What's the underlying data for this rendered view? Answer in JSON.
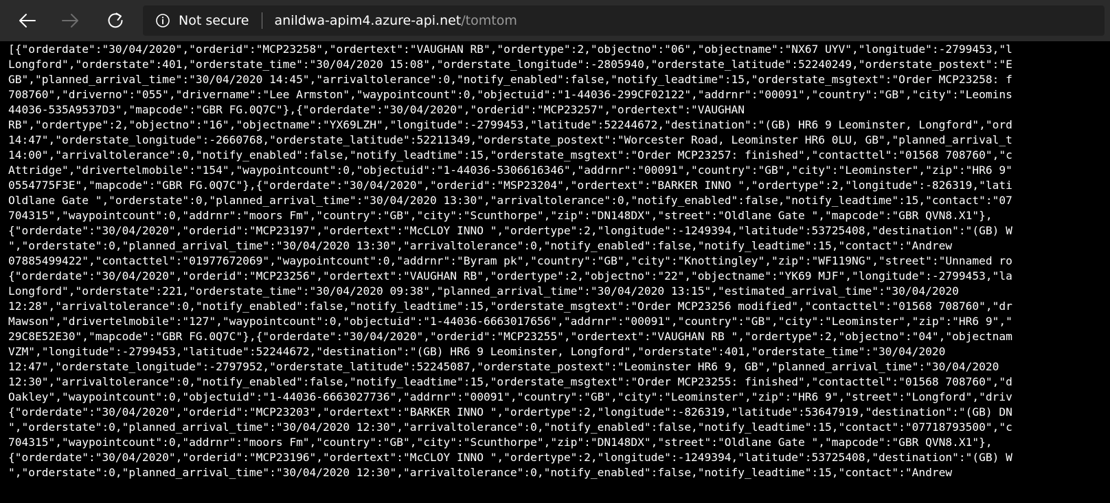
{
  "toolbar": {
    "back_icon": "back-arrow-icon",
    "forward_icon": "forward-arrow-icon",
    "refresh_icon": "refresh-icon",
    "security_icon": "info-circle-icon",
    "security_text": "Not secure",
    "url_host": "anildwa-apim4.azure-api.net",
    "url_path": "/tomtom",
    "colors": {
      "toolbar_bg": "#2b2b2b",
      "addressbar_bg": "#202020",
      "url_path": "#9a9a9a",
      "content_bg": "#000000",
      "content_text": "#ffffff"
    }
  },
  "content": {
    "lines": [
      "[{\"orderdate\":\"30/04/2020\",\"orderid\":\"MCP23258\",\"ordertext\":\"VAUGHAN RB\",\"ordertype\":2,\"objectno\":\"06\",\"objectname\":\"NX67 UYV\",\"longitude\":-2799453,\"l",
      "Longford\",\"orderstate\":401,\"orderstate_time\":\"30/04/2020 15:08\",\"orderstate_longitude\":-2805940,\"orderstate_latitude\":52240249,\"orderstate_postext\":\"E",
      "GB\",\"planned_arrival_time\":\"30/04/2020 14:45\",\"arrivaltolerance\":0,\"notify_enabled\":false,\"notify_leadtime\":15,\"orderstate_msgtext\":\"Order MCP23258: f",
      "708760\",\"driverno\":\"055\",\"drivername\":\"Lee Armston\",\"waypointcount\":0,\"objectuid\":\"1-44036-299CF02122\",\"addrnr\":\"00091\",\"country\":\"GB\",\"city\":\"Leomins",
      "44036-535A9537D3\",\"mapcode\":\"GBR FG.0Q7C\"},{\"orderdate\":\"30/04/2020\",\"orderid\":\"MCP23257\",\"ordertext\":\"VAUGHAN",
      "RB\",\"ordertype\":2,\"objectno\":\"16\",\"objectname\":\"YX69LZH\",\"longitude\":-2799453,\"latitude\":52244672,\"destination\":\"(GB) HR6 9 Leominster, Longford\",\"ord",
      "14:47\",\"orderstate_longitude\":-2660768,\"orderstate_latitude\":52211349,\"orderstate_postext\":\"Worcester Road, Leominster HR6 0LU, GB\",\"planned_arrival_t",
      "14:00\",\"arrivaltolerance\":0,\"notify_enabled\":false,\"notify_leadtime\":15,\"orderstate_msgtext\":\"Order MCP23257: finished\",\"contacttel\":\"01568 708760\",\"c",
      "Attridge\",\"drivertelmobile\":\"154\",\"waypointcount\":0,\"objectuid\":\"1-44036-5306616346\",\"addrnr\":\"00091\",\"country\":\"GB\",\"city\":\"Leominster\",\"zip\":\"HR6 9\"",
      "0554775F3E\",\"mapcode\":\"GBR FG.0Q7C\"},{\"orderdate\":\"30/04/2020\",\"orderid\":\"MSP23204\",\"ordertext\":\"BARKER INNO \",\"ordertype\":2,\"longitude\":-826319,\"lati",
      "Oldlane Gate \",\"orderstate\":0,\"planned_arrival_time\":\"30/04/2020 13:30\",\"arrivaltolerance\":0,\"notify_enabled\":false,\"notify_leadtime\":15,\"contact\":\"07",
      "704315\",\"waypointcount\":0,\"addrnr\":\"moors Fm\",\"country\":\"GB\",\"city\":\"Scunthorpe\",\"zip\":\"DN148DX\",\"street\":\"Oldlane Gate \",\"mapcode\":\"GBR QVN8.X1\"},",
      "{\"orderdate\":\"30/04/2020\",\"orderid\":\"MCP23197\",\"ordertext\":\"McCLOY INNO \",\"ordertype\":2,\"longitude\":-1249394,\"latitude\":53725408,\"destination\":\"(GB) W",
      "\",\"orderstate\":0,\"planned_arrival_time\":\"30/04/2020 13:30\",\"arrivaltolerance\":0,\"notify_enabled\":false,\"notify_leadtime\":15,\"contact\":\"Andrew",
      "07885499422\",\"contacttel\":\"01977672069\",\"waypointcount\":0,\"addrnr\":\"Byram pk\",\"country\":\"GB\",\"city\":\"Knottingley\",\"zip\":\"WF119NG\",\"street\":\"Unnamed ro",
      "{\"orderdate\":\"30/04/2020\",\"orderid\":\"MCP23256\",\"ordertext\":\"VAUGHAN RB\",\"ordertype\":2,\"objectno\":\"22\",\"objectname\":\"YK69 MJF\",\"longitude\":-2799453,\"la",
      "Longford\",\"orderstate\":221,\"orderstate_time\":\"30/04/2020 09:38\",\"planned_arrival_time\":\"30/04/2020 13:15\",\"estimated_arrival_time\":\"30/04/2020",
      "12:28\",\"arrivaltolerance\":0,\"notify_enabled\":false,\"notify_leadtime\":15,\"orderstate_msgtext\":\"Order MCP23256 modified\",\"contacttel\":\"01568 708760\",\"dr",
      "Mawson\",\"drivertelmobile\":\"127\",\"waypointcount\":0,\"objectuid\":\"1-44036-6663017656\",\"addrnr\":\"00091\",\"country\":\"GB\",\"city\":\"Leominster\",\"zip\":\"HR6 9\",\"",
      "29C8E52E30\",\"mapcode\":\"GBR FG.0Q7C\"},{\"orderdate\":\"30/04/2020\",\"orderid\":\"MCP23255\",\"ordertext\":\"VAUGHAN RB \",\"ordertype\":2,\"objectno\":\"04\",\"objectnam",
      "VZM\",\"longitude\":-2799453,\"latitude\":52244672,\"destination\":\"(GB) HR6 9 Leominster, Longford\",\"orderstate\":401,\"orderstate_time\":\"30/04/2020",
      "12:47\",\"orderstate_longitude\":-2797952,\"orderstate_latitude\":52245087,\"orderstate_postext\":\"Leominster HR6 9, GB\",\"planned_arrival_time\":\"30/04/2020",
      "12:30\",\"arrivaltolerance\":0,\"notify_enabled\":false,\"notify_leadtime\":15,\"orderstate_msgtext\":\"Order MCP23255: finished\",\"contacttel\":\"01568 708760\",\"d",
      "Oakley\",\"waypointcount\":0,\"objectuid\":\"1-44036-6663027736\",\"addrnr\":\"00091\",\"country\":\"GB\",\"city\":\"Leominster\",\"zip\":\"HR6 9\",\"street\":\"Longford\",\"driv",
      "{\"orderdate\":\"30/04/2020\",\"orderid\":\"MCP23203\",\"ordertext\":\"BARKER INNO \",\"ordertype\":2,\"longitude\":-826319,\"latitude\":53647919,\"destination\":\"(GB) DN",
      "\",\"orderstate\":0,\"planned_arrival_time\":\"30/04/2020 12:30\",\"arrivaltolerance\":0,\"notify_enabled\":false,\"notify_leadtime\":15,\"contact\":\"07718793500\",\"c",
      "704315\",\"waypointcount\":0,\"addrnr\":\"moors Fm\",\"country\":\"GB\",\"city\":\"Scunthorpe\",\"zip\":\"DN148DX\",\"street\":\"Oldlane Gate \",\"mapcode\":\"GBR QVN8.X1\"},",
      "{\"orderdate\":\"30/04/2020\",\"orderid\":\"MCP23196\",\"ordertext\":\"McCLOY INNO \",\"ordertype\":2,\"longitude\":-1249394,\"latitude\":53725408,\"destination\":\"(GB) W",
      "\",\"orderstate\":0,\"planned_arrival_time\":\"30/04/2020 12:30\",\"arrivaltolerance\":0,\"notify_enabled\":false,\"notify_leadtime\":15,\"contact\":\"Andrew"
    ]
  }
}
